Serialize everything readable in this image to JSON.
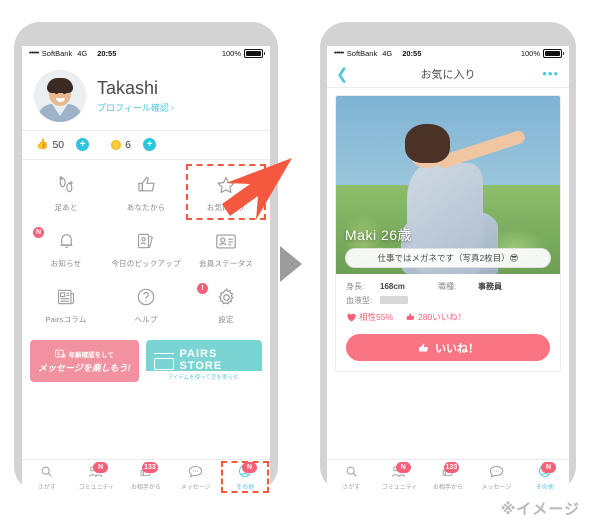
{
  "status_bar": {
    "signal_dots": "•••••",
    "carrier": "SoftBank",
    "network": "4G",
    "time": "20:55",
    "battery_percent": "100%"
  },
  "left_phone": {
    "profile": {
      "name": "Takashi",
      "link_label": "プロフィール確認",
      "link_chevron": "›",
      "avatar_name": "user-avatar"
    },
    "stats": {
      "likes_icon": "thumbs-up-icon",
      "likes_count": "50",
      "coins_icon": "coin-icon",
      "coins_count": "6",
      "add_label": "+"
    },
    "grid": [
      {
        "label": "足あと",
        "icon": "footprints-icon",
        "badge": ""
      },
      {
        "label": "あなたから",
        "icon": "thumbs-up-icon",
        "badge": ""
      },
      {
        "label": "お気に入り",
        "icon": "star-icon",
        "badge": "",
        "highlighted": true
      },
      {
        "label": "お知らせ",
        "icon": "bell-icon",
        "badge": "N"
      },
      {
        "label": "今日のピックアップ",
        "icon": "cards-icon",
        "badge": ""
      },
      {
        "label": "会員ステータス",
        "icon": "id-card-icon",
        "badge": ""
      },
      {
        "label": "Pairsコラム",
        "icon": "newspaper-icon",
        "badge": ""
      },
      {
        "label": "ヘルプ",
        "icon": "question-icon",
        "badge": ""
      },
      {
        "label": "設定",
        "icon": "gear-icon",
        "badge": "!"
      }
    ],
    "banners": {
      "age_verify_line1": "年齢確認をして",
      "age_verify_line2": "メッセージを楽しもう!",
      "store_line1": "PAIRS",
      "store_line2": "STORE",
      "store_sub": "アイテムを使って恋を実らせ."
    }
  },
  "right_phone": {
    "nav": {
      "back_icon": "chevron-left-icon",
      "title": "お気に入り",
      "more_icon": "more-dots-icon"
    },
    "card": {
      "photo_alt": "profile-photo",
      "name": "Maki 26歳",
      "comment": "仕事ではメガネです（写真2枚目）😎",
      "info": [
        {
          "key": "身長:",
          "value": "168cm",
          "key2": "職種:",
          "value2": "事務員"
        },
        {
          "key": "血液型:",
          "value": "",
          "redacted": true,
          "key2": "",
          "value2": ""
        }
      ],
      "match_icon": "heart-icon",
      "match_label": "相性55%",
      "likes_icon": "thumbs-up-icon",
      "likes_label": "280いいね！",
      "like_button": "いいね！",
      "like_button_icon": "thumbs-up-icon"
    }
  },
  "tab_bar": [
    {
      "label": "さがす",
      "icon": "search-icon",
      "badge": "",
      "active": false
    },
    {
      "label": "コミュニティ",
      "icon": "people-icon",
      "badge": "N",
      "active": false
    },
    {
      "label": "お相手から",
      "icon": "thumbs-up-icon",
      "badge": "133",
      "active": false
    },
    {
      "label": "メッセージ",
      "icon": "chat-icon",
      "badge": "",
      "active": false
    },
    {
      "label": "その他",
      "icon": "person-icon",
      "badge": "N",
      "active": true
    }
  ],
  "annotations": {
    "red_arrow": "red-pointer-arrow",
    "flow_arrow": "flow-arrow-right",
    "watermark": "※イメージ"
  },
  "colors": {
    "accent_cyan": "#4ec8dd",
    "accent_pink": "#f8607a",
    "like_button": "#fa7584",
    "annotation_red": "#f4593f",
    "frame_gray": "#d3d3d3"
  }
}
